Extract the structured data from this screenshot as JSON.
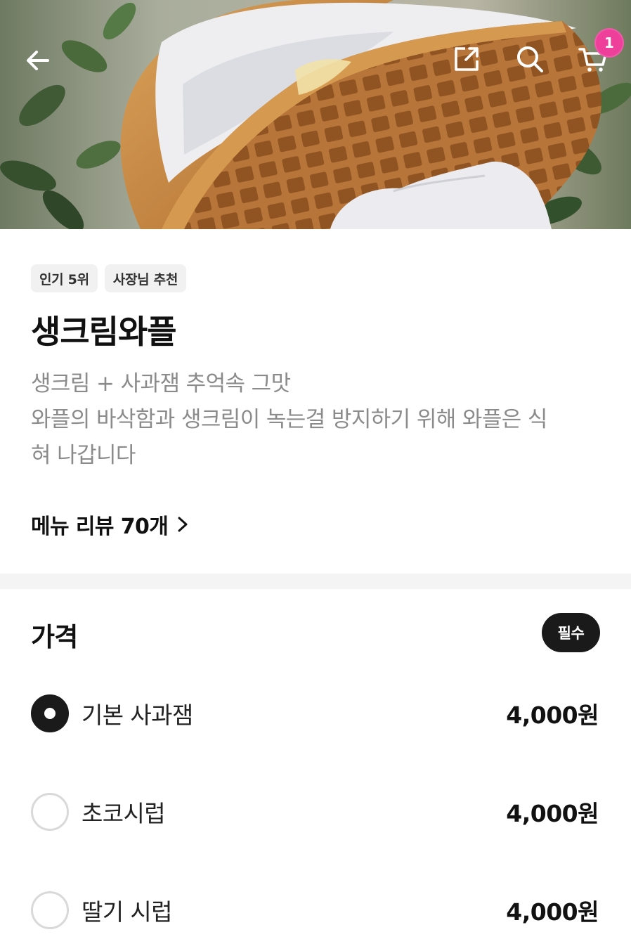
{
  "header": {
    "cart_count": "1",
    "icons": {
      "back": "arrow-left-icon",
      "share": "share-icon",
      "search": "search-icon",
      "cart": "cart-icon"
    }
  },
  "menu": {
    "tags": [
      "인기 5위",
      "사장님 추천"
    ],
    "title": "생크림와플",
    "description_lines": [
      "생크림 + 사과잼 추억속 그맛",
      "와플의 바삭함과 생크림이 녹는걸 방지하기 위해 와플은 식",
      "혀 나갑니다"
    ],
    "reviews_label": "메뉴 리뷰 70개"
  },
  "price": {
    "title": "가격",
    "required_label": "필수",
    "options": [
      {
        "label": "기본 사과잼",
        "price": "4,000원",
        "selected": true
      },
      {
        "label": "초코시럽",
        "price": "4,000원",
        "selected": false
      },
      {
        "label": "딸기 시럽",
        "price": "4,000원",
        "selected": false
      }
    ]
  },
  "colors": {
    "badge": "#ee3f9b",
    "primary_dark": "#1a1a1a",
    "muted_text": "#8b8b8b",
    "divider": "#f4f4f4"
  }
}
